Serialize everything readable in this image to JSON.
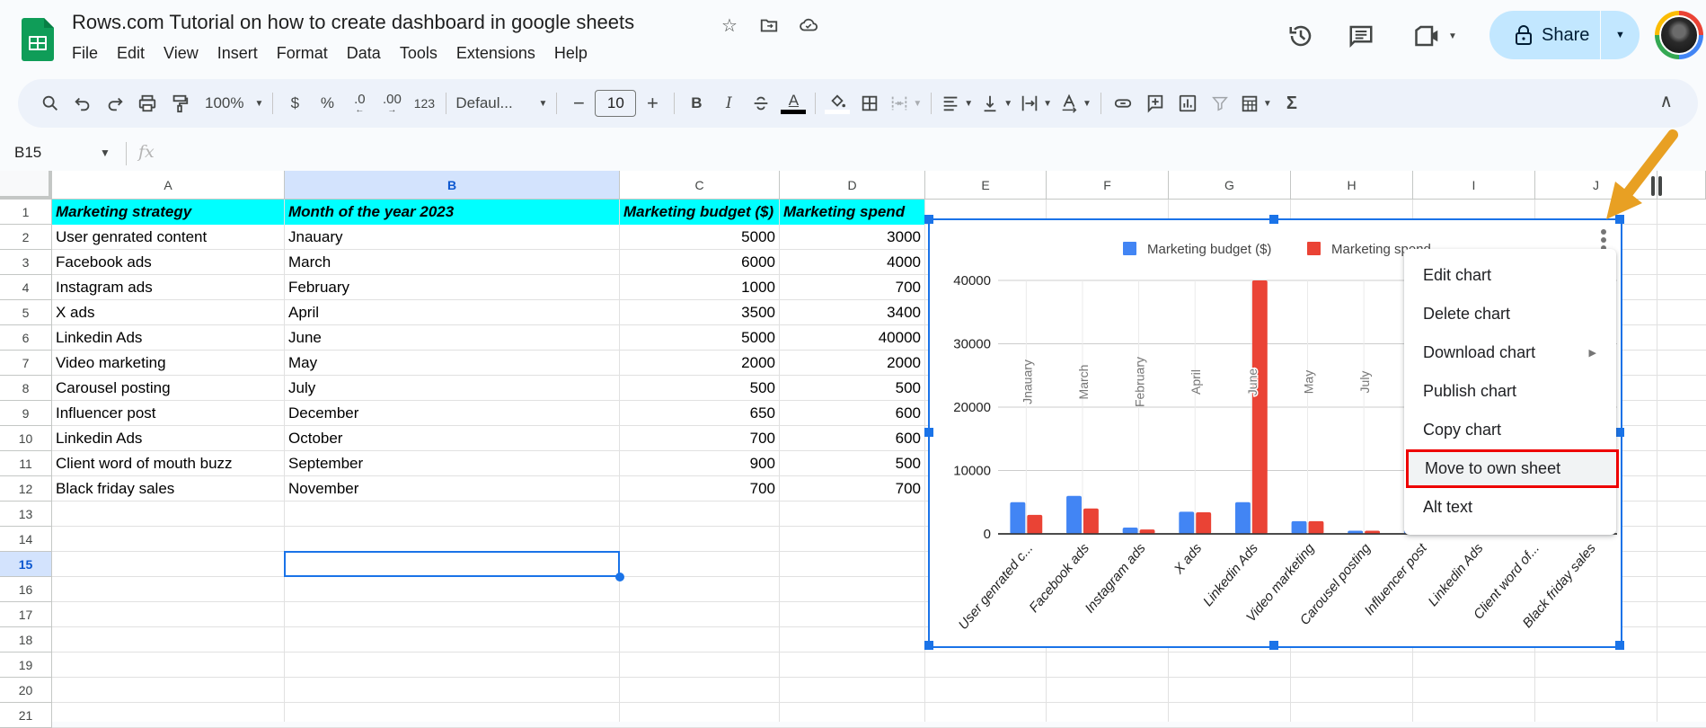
{
  "app": {
    "title": "Rows.com Tutorial on how to create dashboard in google sheets",
    "menus": [
      "File",
      "Edit",
      "View",
      "Insert",
      "Format",
      "Data",
      "Tools",
      "Extensions",
      "Help"
    ],
    "share_label": "Share"
  },
  "toolbar": {
    "zoom": "100%",
    "currency": "$",
    "percent": "%",
    "decrease_decimal": ".0",
    "increase_decimal": ".00",
    "number_format": "123",
    "font": "Defaul...",
    "font_size": "10",
    "bold": "B",
    "italic": "I",
    "text_color_letter": "A",
    "sum": "Σ"
  },
  "formula_bar": {
    "name_box": "B15",
    "fx": "fx",
    "value": ""
  },
  "columns": [
    "A",
    "B",
    "C",
    "D",
    "E",
    "F",
    "G",
    "H",
    "I",
    "J"
  ],
  "selected_column": "B",
  "rows": [
    "1",
    "2",
    "3",
    "4",
    "5",
    "6",
    "7",
    "8",
    "9",
    "10",
    "11",
    "12",
    "13",
    "14",
    "15",
    "16",
    "17",
    "18",
    "19",
    "20",
    "21"
  ],
  "selected_row": "15",
  "sheet": {
    "headers": [
      "Marketing strategy",
      "Month of the year 2023",
      "Marketing budget ($)",
      "Marketing spend"
    ],
    "header_bg": "#00ffff",
    "data": [
      [
        "User genrated content",
        "Jnauary",
        "5000",
        "3000"
      ],
      [
        "Facebook ads",
        "March",
        "6000",
        "4000"
      ],
      [
        "Instagram ads",
        "February",
        "1000",
        "700"
      ],
      [
        "X ads",
        "April",
        "3500",
        "3400"
      ],
      [
        "Linkedin Ads",
        "June",
        "5000",
        "40000"
      ],
      [
        "Video marketing",
        "May",
        "2000",
        "2000"
      ],
      [
        "Carousel posting",
        "July",
        "500",
        "500"
      ],
      [
        "Influencer post",
        "December",
        "650",
        "600"
      ],
      [
        "Linkedin Ads",
        "October",
        "700",
        "600"
      ],
      [
        "Client word of mouth buzz",
        "September",
        "900",
        "500"
      ],
      [
        "Black friday sales",
        "November",
        "700",
        "700"
      ]
    ]
  },
  "chart_data": {
    "type": "bar",
    "title": "",
    "categories": [
      "User genrated c...",
      "Facebook ads",
      "Instagram ads",
      "X ads",
      "Linkedin Ads",
      "Video marketing",
      "Carousel posting",
      "Influencer post",
      "Linkedin Ads",
      "Client word of...",
      "Black friday sales"
    ],
    "month_labels": [
      "Jnauary",
      "March",
      "February",
      "April",
      "June",
      "May",
      "July"
    ],
    "series": [
      {
        "name": "Marketing budget ($)",
        "color": "#4285f4",
        "values": [
          5000,
          6000,
          1000,
          3500,
          5000,
          2000,
          500,
          650,
          700,
          900,
          700
        ]
      },
      {
        "name": "Marketing spend",
        "color": "#ea4335",
        "values": [
          3000,
          4000,
          700,
          3400,
          40000,
          2000,
          500,
          600,
          600,
          500,
          700
        ]
      }
    ],
    "legend_labels": [
      "Marketing budget ($)",
      "Marketing spend"
    ],
    "y_ticks": [
      "0",
      "10000",
      "20000",
      "30000",
      "40000"
    ],
    "ylim": [
      0,
      40000
    ],
    "grid": true,
    "legend": "top"
  },
  "context_menu": {
    "items": [
      {
        "label": "Edit chart"
      },
      {
        "label": "Delete chart"
      },
      {
        "label": "Download chart",
        "submenu": true
      },
      {
        "label": "Publish chart"
      },
      {
        "label": "Copy chart"
      },
      {
        "label": "Move to own sheet",
        "highlighted": true
      },
      {
        "label": "Alt text"
      }
    ]
  },
  "annotation": {
    "arrow_color": "#e8a023",
    "highlight_color": "#ee0000"
  }
}
